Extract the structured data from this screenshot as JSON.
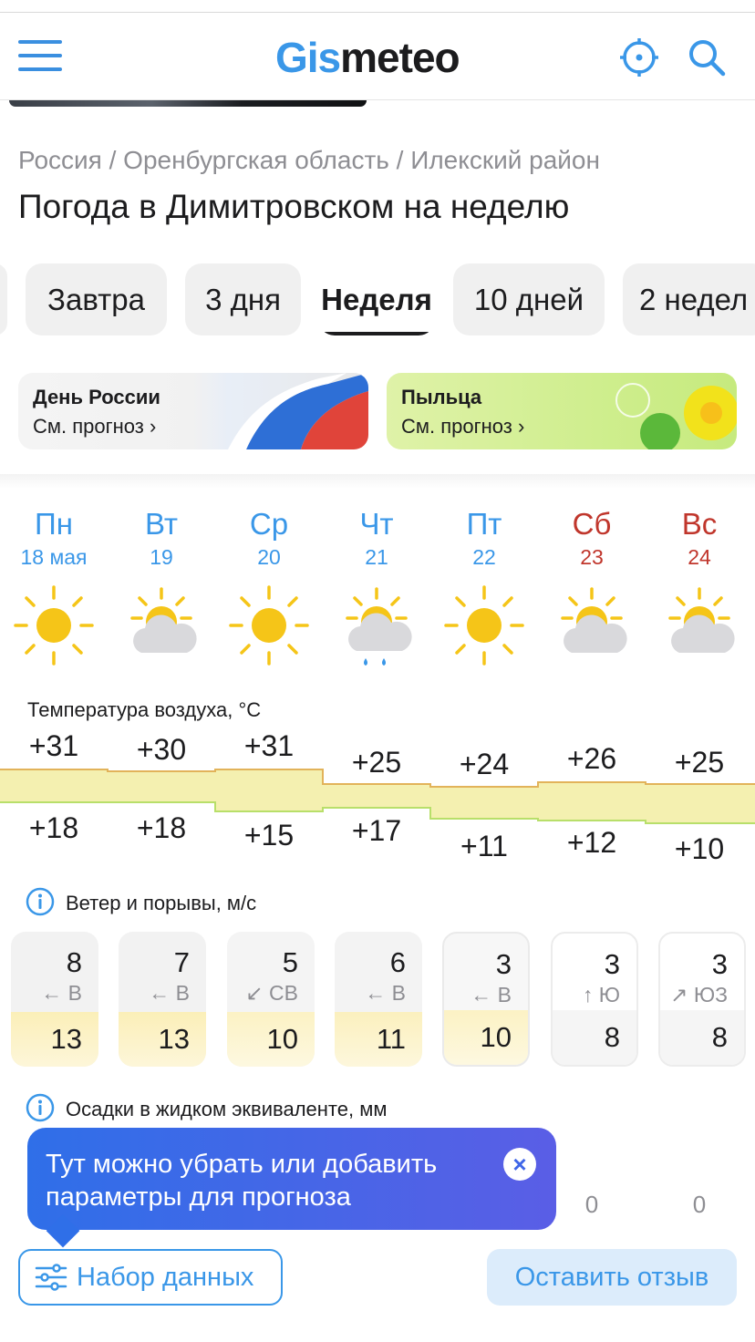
{
  "header": {
    "logo_part1": "Gis",
    "logo_part2": "meteo",
    "icons": [
      "menu-icon",
      "location-target-icon",
      "search-icon"
    ]
  },
  "breadcrumb": "Россия / Оренбургская область / Илекский район",
  "page_title": "Погода в Димитровском на неделю",
  "tabs": [
    {
      "label": "Завтра",
      "active": false
    },
    {
      "label": "3 дня",
      "active": false
    },
    {
      "label": "Неделя",
      "active": true
    },
    {
      "label": "10 дней",
      "active": false
    },
    {
      "label": "2 недел",
      "active": false
    }
  ],
  "promos": [
    {
      "title": "День России",
      "link": "См. прогноз ›"
    },
    {
      "title": "Пыльца",
      "link": "См. прогноз ›"
    }
  ],
  "days": [
    {
      "name": "Пн",
      "date": "18 мая",
      "weekend": false,
      "icon": "sun-icon"
    },
    {
      "name": "Вт",
      "date": "19",
      "weekend": false,
      "icon": "partly-cloudy-icon"
    },
    {
      "name": "Ср",
      "date": "20",
      "weekend": false,
      "icon": "sun-icon"
    },
    {
      "name": "Чт",
      "date": "21",
      "weekend": false,
      "icon": "partly-cloudy-rain-icon"
    },
    {
      "name": "Пт",
      "date": "22",
      "weekend": false,
      "icon": "sun-icon"
    },
    {
      "name": "Сб",
      "date": "23",
      "weekend": true,
      "icon": "partly-cloudy-icon"
    },
    {
      "name": "Вс",
      "date": "24",
      "weekend": true,
      "icon": "partly-cloudy-icon"
    }
  ],
  "temperature": {
    "label": "Температура воздуха, °C",
    "max": [
      "+31",
      "+30",
      "+31",
      "+25",
      "+24",
      "+26",
      "+25"
    ],
    "min": [
      "+18",
      "+18",
      "+15",
      "+17",
      "+11",
      "+12",
      "+10"
    ]
  },
  "wind": {
    "label": "Ветер и порывы, м/с",
    "speed": [
      "8",
      "7",
      "5",
      "6",
      "3",
      "3",
      "3"
    ],
    "direction": [
      "← В",
      "← В",
      "↙ СВ",
      "← В",
      "← В",
      "↑ Ю",
      "↗ ЮЗ"
    ],
    "gusts": [
      "13",
      "13",
      "10",
      "11",
      "10",
      "8",
      "8"
    ]
  },
  "precipitation": {
    "label": "Осадки в жидком эквиваленте, мм",
    "values": [
      "",
      "",
      "",
      "",
      "",
      "0",
      "0"
    ]
  },
  "tooltip": {
    "text": "Тут можно убрать или добавить параметры для прогноза",
    "close": "×"
  },
  "bottom": {
    "data_button": "Набор данных",
    "review_button": "Оставить отзыв"
  },
  "colors": {
    "accent": "#3a97e8",
    "weekend": "#c0362c",
    "tooltip": "#2f6fe8"
  }
}
